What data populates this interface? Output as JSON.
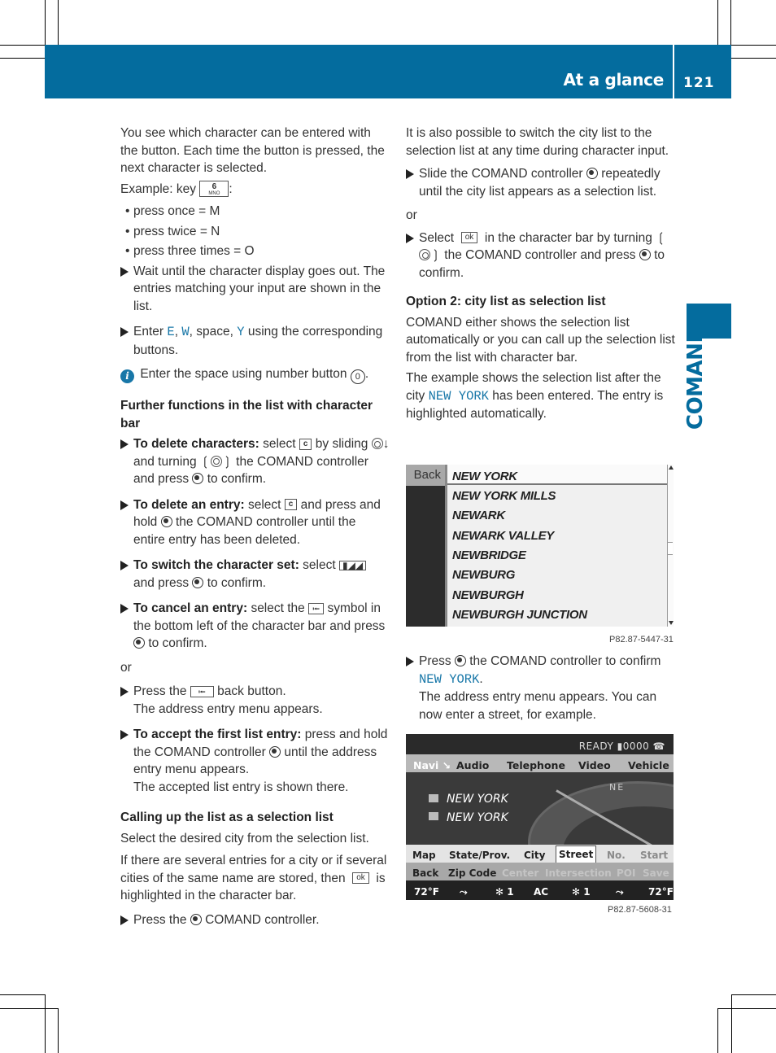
{
  "header": {
    "title": "At a glance",
    "page_number": "121"
  },
  "side_tab": {
    "label": "COMAND"
  },
  "accent_color": "#046c9e",
  "left_column": {
    "intro": "You see which character can be entered with the button. Each time the button is pressed, the next character is selected.",
    "example_prefix": "Example: key",
    "example_suffix": ":",
    "example_key": {
      "number": "6",
      "letters": "MNO"
    },
    "presses": [
      "press once = M",
      "press twice = N",
      "press three times = O"
    ],
    "wait_step": "Wait until the character display goes out. The entries matching your input are shown in the list.",
    "enter_step": {
      "prefix": "Enter",
      "e": "E",
      "sep1": ",",
      "w": "W",
      "mid": ", space,",
      "y": "Y",
      "suffix": "using the corresponding buttons."
    },
    "info_note": {
      "text": "Enter the space using number button",
      "button": "0",
      "end": "."
    },
    "further_heading": "Further functions in the list with character bar",
    "delete_chars": {
      "label": "To delete characters:",
      "t1": "select",
      "key": "c",
      "t2": "by sliding",
      "t3": "and turning",
      "t4": "the COMAND controller and press",
      "t5": "to confirm."
    },
    "delete_entry": {
      "label": "To delete an entry:",
      "t1": "select",
      "key": "c",
      "t2": "and press and hold",
      "t3": "the COMAND controller until the entire entry has been deleted."
    },
    "switch_set": {
      "label": "To switch the character set:",
      "t1": "select",
      "t2": "and press",
      "t3": "to confirm."
    },
    "cancel_entry": {
      "label": "To cancel an entry:",
      "t1": "select the",
      "t2": "symbol in the bottom left of the character bar and press",
      "t3": "to confirm."
    },
    "or": "or",
    "back_step": {
      "t1": "Press the",
      "t2": "back button.",
      "t3": "The address entry menu appears."
    },
    "accept_first": {
      "label": "To accept the first list entry:",
      "t1": "press and hold the COMAND controller",
      "t2": "until the address entry menu appears.",
      "t3": "The accepted list entry is shown there."
    },
    "calling_heading": "Calling up the list as a selection list",
    "calling_p1": "Select the desired city from the selection list.",
    "calling_p2a": "If there are several entries for a city or if several cities of the same name are stored, then",
    "ok_key": "ok",
    "calling_p2b": "is highlighted in the character bar.",
    "press_step": {
      "t1": "Press the",
      "t2": "COMAND controller."
    }
  },
  "right_column": {
    "intro": "It is also possible to switch the city list to the selection list at any time during character input.",
    "slide_step": {
      "t1": "Slide the COMAND controller",
      "t2": "repeatedly until the city list appears as a selection list."
    },
    "or": "or",
    "select_ok_step": {
      "t1": "Select",
      "key": "ok",
      "t2": "in the character bar by turning",
      "t3": "the COMAND controller and press",
      "t4": "to confirm."
    },
    "option2_heading": "Option 2: city list as selection list",
    "option2_p1": "COMAND either shows the selection list automatically or you can call up the selection list from the list with character bar.",
    "option2_p2a": "The example shows the selection list after the city",
    "option2_city": "NEW YORK",
    "option2_p2b": "has been entered. The entry is highlighted automatically.",
    "confirm_step": {
      "t1": "Press",
      "t2": "the COMAND controller to confirm",
      "city": "NEW YORK",
      "t3": ".",
      "t4": "The address entry menu appears. You can now enter a street, for example."
    }
  },
  "screen_city_list": {
    "back_label": "Back",
    "items": [
      "NEW YORK",
      "NEW YORK MILLS",
      "NEWARK",
      "NEWARK VALLEY",
      "NEWBRIDGE",
      "NEWBURG",
      "NEWBURGH",
      "NEWBURGH JUNCTION"
    ],
    "selected_index": 0,
    "caption": "P82.87-5447-31"
  },
  "screen_address": {
    "status": "READY ▮0000 ☎",
    "menu": [
      "Navi ↘",
      "Audio",
      "Telephone",
      "Video",
      "Vehicle"
    ],
    "compass_label": "NE",
    "destinations": [
      "NEW YORK",
      "NEW YORK"
    ],
    "row1": [
      "Map",
      "State/Prov.",
      "City",
      "Street",
      "No.",
      "Start"
    ],
    "row1_selected": "Street",
    "row2": [
      "Back",
      "Zip Code",
      "Center",
      "Intersection",
      "POI",
      "Save"
    ],
    "climate": [
      "72°F",
      "⤳",
      "✻ 1",
      "AC",
      "✻ 1",
      "⤳",
      "72°F"
    ],
    "caption": "P82.87-5608-31"
  }
}
